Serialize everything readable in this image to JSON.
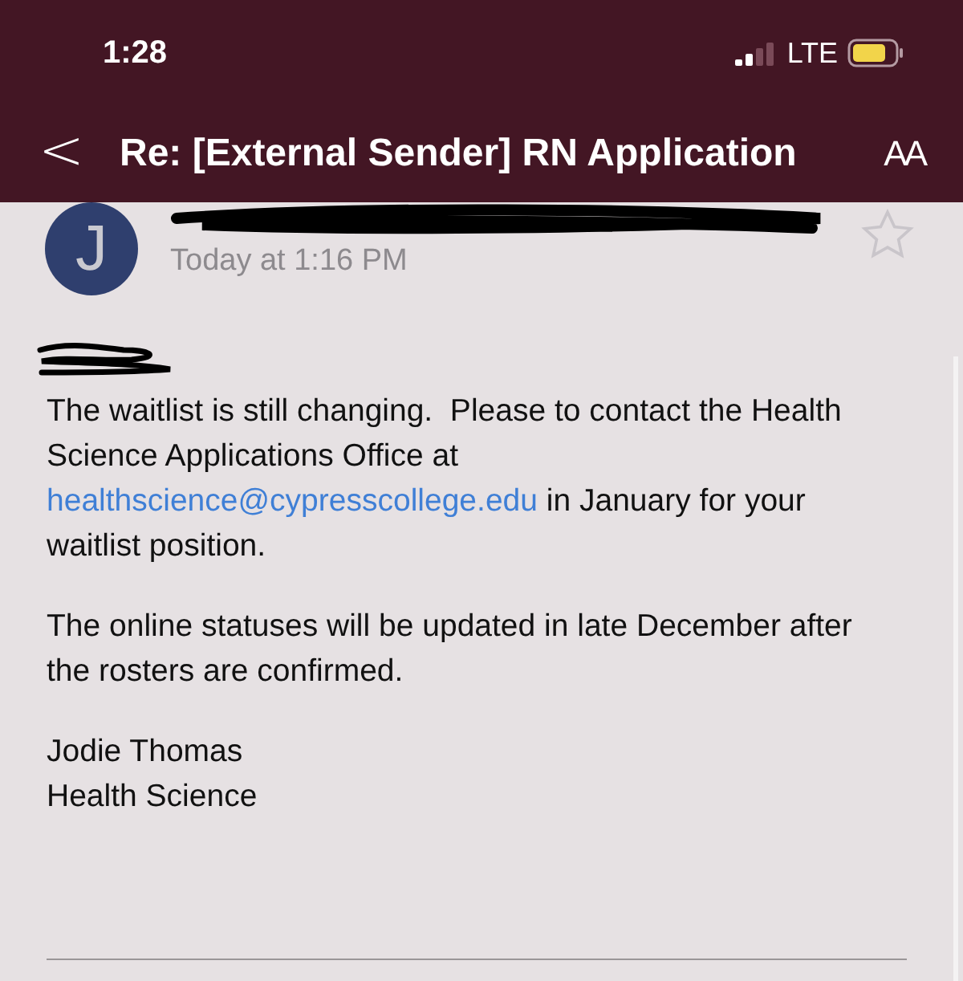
{
  "status_bar": {
    "time": "1:28",
    "network": "LTE"
  },
  "nav_bar": {
    "back": "<",
    "title": "Re: [External Sender] RN Application",
    "text_size": "AA"
  },
  "message": {
    "avatar_initial": "J",
    "date": "Today at 1:16 PM",
    "starred": false,
    "paragraphs": [
      {
        "parts": [
          {
            "kind": "text",
            "text": "The waitlist is still changing.  Please to contact the Health Science Applications Office at "
          },
          {
            "kind": "link",
            "text": "healthscience@cypresscollege.edu"
          },
          {
            "kind": "text",
            "text": " in January for your waitlist position."
          }
        ]
      },
      {
        "parts": [
          {
            "kind": "text",
            "text": "The online statuses will be updated in late December after the rosters are confirmed."
          }
        ]
      }
    ],
    "signature": [
      "Jodie Thomas",
      "Health Science"
    ]
  }
}
